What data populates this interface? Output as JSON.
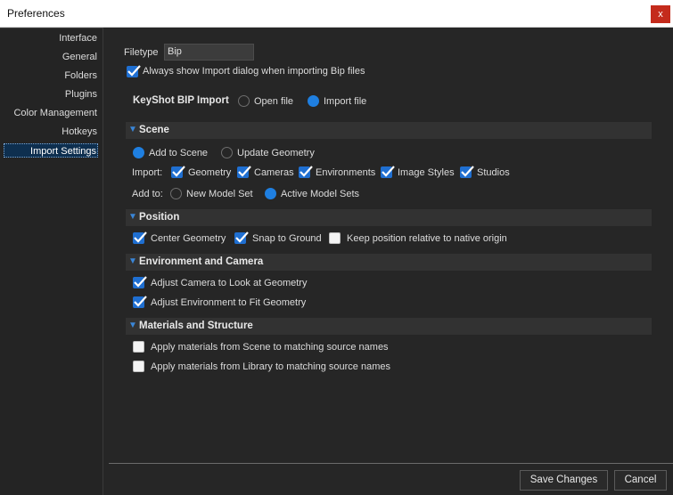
{
  "window": {
    "title": "Preferences",
    "close_label": "x"
  },
  "sidebar": {
    "items": [
      {
        "label": "Interface"
      },
      {
        "label": "General"
      },
      {
        "label": "Folders"
      },
      {
        "label": "Plugins"
      },
      {
        "label": "Color Management"
      },
      {
        "label": "Hotkeys"
      },
      {
        "label": "Import Settings",
        "active": true
      }
    ]
  },
  "filetype": {
    "label": "Filetype",
    "value": "Bip"
  },
  "always_show": {
    "label": "Always show Import dialog when importing Bip files",
    "checked": true
  },
  "bip_import": {
    "label": "KeyShot BIP Import",
    "open_file": "Open file",
    "import_file": "Import file",
    "selected": "import_file"
  },
  "scene": {
    "title": "Scene",
    "add_to_scene": "Add to Scene",
    "update_geometry": "Update Geometry",
    "import_label": "Import:",
    "import_items": [
      "Geometry",
      "Cameras",
      "Environments",
      "Image Styles",
      "Studios"
    ],
    "add_to_label": "Add to:",
    "new_model_set": "New Model Set",
    "active_model_sets": "Active Model Sets"
  },
  "position": {
    "title": "Position",
    "center_geometry": "Center Geometry",
    "snap_to_ground": "Snap to Ground",
    "keep_position": "Keep position relative to native origin"
  },
  "environment_camera": {
    "title": "Environment and Camera",
    "adjust_camera": "Adjust Camera to Look at Geometry",
    "adjust_environment": "Adjust Environment to Fit Geometry"
  },
  "materials": {
    "title": "Materials and Structure",
    "from_scene": "Apply materials from Scene to matching source names",
    "from_library": "Apply materials from Library to matching source names"
  },
  "footer": {
    "save_label": "Save Changes",
    "cancel_label": "Cancel"
  },
  "colors": {
    "accent": "#1f7fe0",
    "background": "#262626",
    "section": "#323232",
    "close": "#c42b1c"
  },
  "icons": {
    "section_toggle": "chevron-down-icon",
    "check": "check-icon"
  }
}
